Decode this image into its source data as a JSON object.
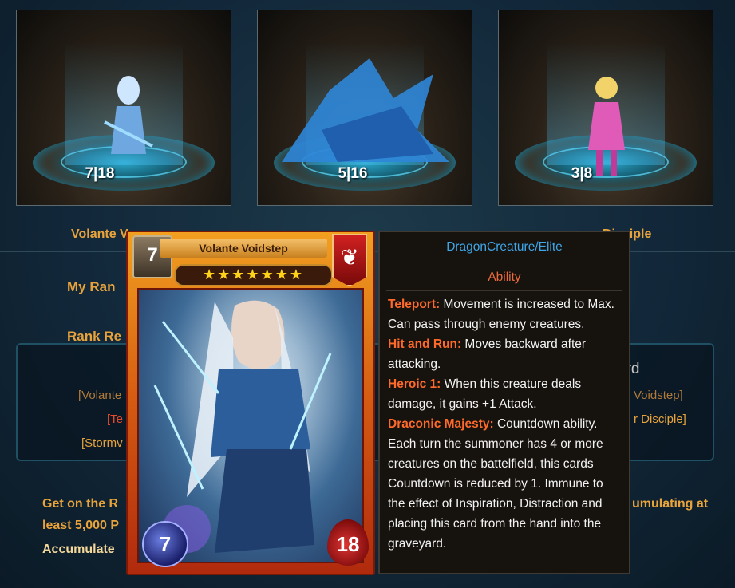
{
  "tiles": [
    {
      "stat": "7|18"
    },
    {
      "stat": "5|16"
    },
    {
      "stat": "3|8"
    }
  ],
  "labels": {
    "tile1_name": "Volante V",
    "tile3_name": "Disciple",
    "my_rank": "My Ran",
    "rank_rewards": "Rank Re"
  },
  "reward_box": {
    "rank_right": "3rd",
    "left_items": [
      "[Volante",
      "[Te",
      "[Stormv"
    ],
    "right_items": [
      "Voidstep]",
      "r Disciple]"
    ]
  },
  "bottom": {
    "line1_left": "Get on the R",
    "line1_right": "umulating at",
    "line2": "least 5,000 P",
    "line3": "Accumulate"
  },
  "card": {
    "name": "Volante Voidstep",
    "cost": "7",
    "stars": "★★★★★★★",
    "attack": "7",
    "health": "18"
  },
  "tooltip": {
    "type": "DragonCreature/Elite",
    "section": "Ability",
    "abilities": [
      {
        "name": "Teleport:",
        "text": " Movement is increased to Max. Can pass through enemy creatures."
      },
      {
        "name": "Hit and Run:",
        "text": " Moves backward after attacking."
      },
      {
        "name": "Heroic 1:",
        "text": " When this creature deals damage, it gains +1 Attack."
      },
      {
        "name": "Draconic Majesty:",
        "text": " Countdown ability. Each turn the summoner has 4 or more creatures on the battelfield, this cards Countdown is reduced by 1. Immune to the effect of Inspiration, Distraction and placing this card from the hand into the graveyard."
      }
    ]
  },
  "colors": {
    "accent_orange": "#e8a33b",
    "ability_name": "#ff6a2a",
    "type_blue": "#3fa6e8"
  }
}
